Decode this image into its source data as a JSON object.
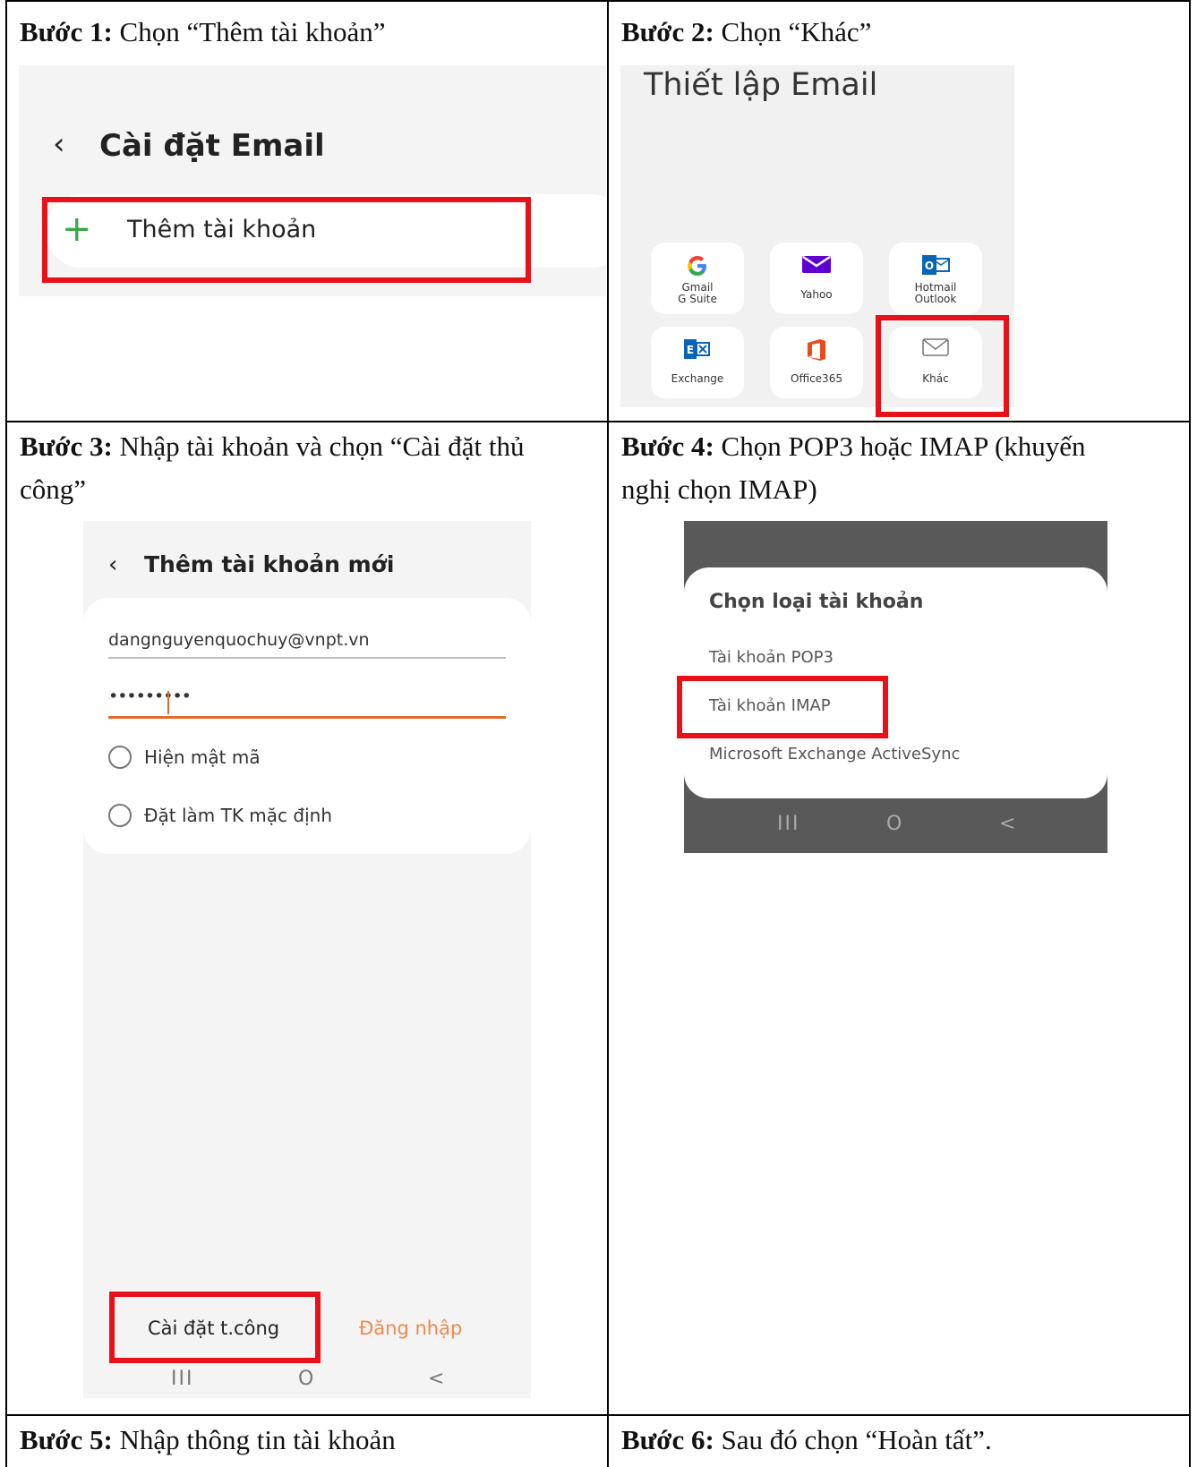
{
  "step1": {
    "caption_bold": "Bước 1:",
    "caption_text": " Chọn “Thêm  tài khoản”",
    "screen_title": "Cài đặt Email",
    "add_account": "Thêm tài khoản",
    "back_icon": "chevron-left-icon",
    "plus_icon": "plus-icon"
  },
  "step2": {
    "caption_bold": "Bước 2:",
    "caption_text": " Chọn “Khác”",
    "screen_title": "Thiết lập Email",
    "tiles": [
      {
        "line1": "Gmail",
        "line2": "G Suite",
        "icon": "google-icon"
      },
      {
        "line1": "Yahoo",
        "line2": "",
        "icon": "yahoo-mail-icon"
      },
      {
        "line1": "Hotmail",
        "line2": "Outlook",
        "icon": "outlook-icon"
      },
      {
        "line1": "Exchange",
        "line2": "",
        "icon": "exchange-icon"
      },
      {
        "line1": "Office365",
        "line2": "",
        "icon": "office365-icon"
      },
      {
        "line1": "Khác",
        "line2": "",
        "icon": "envelope-icon"
      }
    ]
  },
  "step3": {
    "caption_bold": "Bước 3:",
    "caption_text_line1": " Nhập tài khoản  và  chọn “Cài  đặt thủ",
    "caption_text_line2": "công”",
    "screen_title": "Thêm tài khoản mới",
    "email_value": "dangnguyenquochuy@vnpt.vn",
    "password_value": "•••••••••",
    "show_password": "Hiện mật mã",
    "set_default": "Đặt làm TK mặc định",
    "manual_setup": "Cài đặt t.công",
    "login": "Đăng nhập"
  },
  "step4": {
    "caption_bold": "Bước 4:",
    "caption_text_line1": " Chọn POP3 hoặc IMAP (khuyến",
    "caption_text_line2": "nghị chọn IMAP)",
    "dialog_title": "Chọn loại tài khoản",
    "options": [
      "Tài khoản POP3",
      "Tài khoản IMAP",
      "Microsoft Exchange ActiveSync"
    ]
  },
  "step5": {
    "caption_bold": "Bước 5:",
    "caption_text": " Nhập  thông tin tài khoản"
  },
  "step6": {
    "caption_bold": "Bước 6:",
    "caption_text": " Sau  đó chọn “Hoàn  tất”."
  },
  "navbar": {
    "recent": "III",
    "home": "O",
    "back": "<"
  },
  "colors": {
    "highlight": "#e8111a",
    "accent_orange": "#e46a2c",
    "plus_green": "#3aa64a"
  }
}
